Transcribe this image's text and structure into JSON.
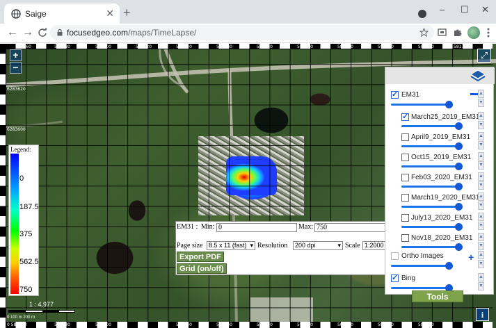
{
  "browser": {
    "tab_title": "Saige",
    "tab_close": "✕",
    "new_tab": "+",
    "url_host": "focusedgeo.com",
    "url_path": "/maps/TimeLapse/",
    "back_glyph": "←",
    "forward_glyph": "→",
    "reload_glyph": "C",
    "minimize_glyph": "–",
    "maximize_glyph": "☐",
    "close_glyph": "✕"
  },
  "map": {
    "zoom_in": "+",
    "zoom_out": "−",
    "fullscreen_glyph": "⤢",
    "info_glyph": "i",
    "top_coords": [
      "581560",
      "581580",
      "581600",
      "581620",
      "581640",
      "581660",
      "581680",
      "581700",
      "581720",
      "581740",
      "581760",
      "581780"
    ],
    "left_coords": [
      "6283620",
      "6283600"
    ],
    "bottom_coords": [
      "581580",
      "581600",
      "581620",
      "581640",
      "581660",
      "581680",
      "581700",
      "581720",
      "581740",
      "581760"
    ],
    "bottom_left_coord": "0 583640",
    "scale_ratio": "1 : 4,977",
    "scale_text": "0   100 m   200 m"
  },
  "legend": {
    "title": "Legend:",
    "ticks": [
      "0",
      "187.5",
      "375",
      "562.5",
      "750"
    ]
  },
  "export_panel": {
    "layer_label": "EM31 :",
    "min_label": "Min:",
    "min_value": "0",
    "max_label": "Max:",
    "max_value": "750",
    "page_size_label": "Page size",
    "page_size_value": "8.5 x 11 (fast)",
    "resolution_label": "Resolution",
    "resolution_value": "200 dpi",
    "scale_label": "Scale",
    "scale_value": "1:2000",
    "export_pdf": "Export PDF",
    "grid_toggle": "Grid (on/off)"
  },
  "layers": {
    "group_label": "EM31",
    "items": [
      {
        "label": "March25_2019_EM31",
        "checked": true
      },
      {
        "label": "April9_2019_EM31",
        "checked": false
      },
      {
        "label": "Oct15_2019_EM31",
        "checked": false
      },
      {
        "label": "Feb03_2020_EM31",
        "checked": false
      },
      {
        "label": "March19_2020_EM31",
        "checked": false
      },
      {
        "label": "July13_2020_EM31",
        "checked": false
      },
      {
        "label": "Nov18_2020_EM31",
        "checked": false
      }
    ],
    "ortho_label": "Ortho Images",
    "bing_label": "Bing",
    "tools_label": "Tools"
  },
  "colors": {
    "accent_blue": "#1558d6",
    "button_green": "#6c8f4e",
    "tools_green": "#7ea34b"
  }
}
